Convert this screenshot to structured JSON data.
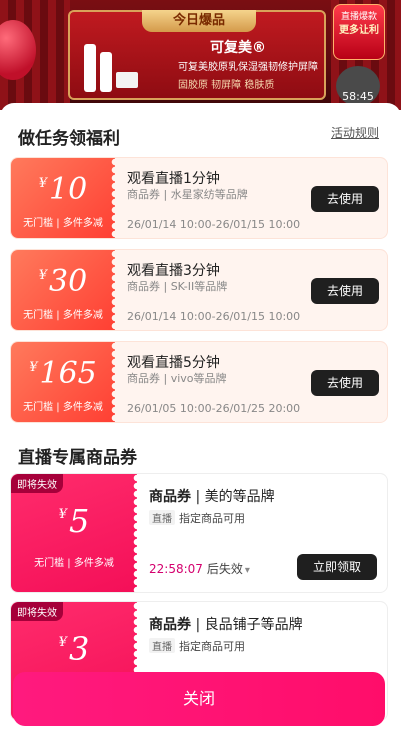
{
  "banner": {
    "tag": "今日爆品",
    "brand": "可复美®",
    "subtitle": "可复美胶原乳保湿强韧修护屏障",
    "features": "固胶原 韧屏障 稳肤质",
    "side_badge_top": "直播爆款",
    "side_badge_bottom": "更多让利",
    "timer": "58:45"
  },
  "tasks_section": {
    "title": "做任务领福利",
    "rules_link": "活动规则",
    "tasks": [
      {
        "currency": "¥",
        "amount": "10",
        "condition": "无门槛 | 多件多减",
        "title": "观看直播1分钟",
        "subtitle": "商品券 | 水星家纺等品牌",
        "date": "26/01/14 10:00-26/01/15 10:00",
        "button": "去使用"
      },
      {
        "currency": "¥",
        "amount": "30",
        "condition": "无门槛 | 多件多减",
        "title": "观看直播3分钟",
        "subtitle": "商品券 | SK-II等品牌",
        "date": "26/01/14 10:00-26/01/15 10:00",
        "button": "去使用"
      },
      {
        "currency": "¥",
        "amount": "165",
        "condition": "无门槛 | 多件多减",
        "title": "观看直播5分钟",
        "subtitle": "商品券 | vivo等品牌",
        "date": "26/01/05 10:00-26/01/25 20:00",
        "button": "去使用"
      }
    ]
  },
  "live_section": {
    "title": "直播专属商品券",
    "coupons": [
      {
        "expire_tag": "即将失效",
        "currency": "¥",
        "amount": "5",
        "condition": "无门槛 | 多件多减",
        "title_bold": "商品券",
        "title_rest": " | 美的等品牌",
        "scope_tag": "直播",
        "scope": "指定商品可用",
        "countdown": "22:58:07",
        "countdown_label": "后失效",
        "chevron": "▾",
        "button": "立即领取"
      },
      {
        "expire_tag": "即将失效",
        "currency": "¥",
        "amount": "3",
        "condition": "",
        "title_bold": "商品券",
        "title_rest": " | 良品铺子等品牌",
        "scope_tag": "直播",
        "scope": "指定商品可用",
        "countdown": "",
        "countdown_label": "",
        "chevron": "",
        "button": ""
      }
    ]
  },
  "footer": {
    "close": "关闭"
  }
}
